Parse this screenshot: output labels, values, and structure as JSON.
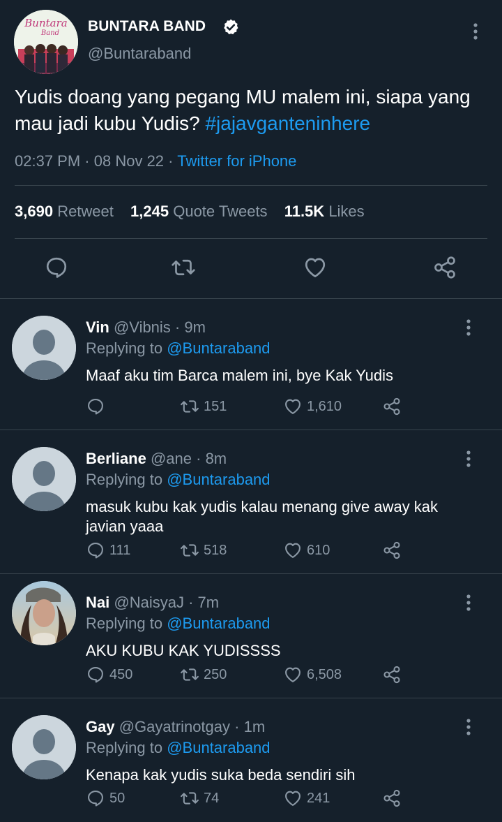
{
  "tweet": {
    "author_name": "BUNTARA BAND",
    "author_handle": "@Buntaraband",
    "avatar_logo_text": "Buntara Band",
    "text": "Yudis doang yang pegang MU malem ini, siapa yang mau jadi kubu Yudis? ",
    "hashtag": "#jajavganteninhere",
    "time": "02:37 PM",
    "date": "08 Nov 22",
    "source": "Twitter for iPhone",
    "retweets": "3,690",
    "retweets_label": "Retweet",
    "quotes": "1,245",
    "quotes_label": "Quote Tweets",
    "likes": "11.5K",
    "likes_label": "Likes"
  },
  "replies": [
    {
      "name": "Vin",
      "handle": "@Vibnis",
      "time": "9m",
      "replying_label": "Replying to",
      "mention": "@Buntaraband",
      "text": "Maaf aku tim Barca malem ini, bye Kak Yudis",
      "reply_count": "",
      "retweet_count": "151",
      "like_count": "1,610"
    },
    {
      "name": "Berliane",
      "handle": "@ane",
      "time": "8m",
      "replying_label": "Replying to",
      "mention": "@Buntaraband",
      "text": "masuk kubu kak yudis kalau menang give away kak javian yaaa",
      "reply_count": "111",
      "retweet_count": "518",
      "like_count": "610"
    },
    {
      "name": "Nai",
      "handle": "@NaisyaJ",
      "time": "7m",
      "replying_label": "Replying to",
      "mention": "@Buntaraband",
      "text": "AKU KUBU KAK YUDISSSS",
      "reply_count": "450",
      "retweet_count": "250",
      "like_count": "6,508"
    },
    {
      "name": "Gay",
      "handle": "@Gayatrinotgay",
      "time": "1m",
      "replying_label": "Replying to",
      "mention": "@Buntaraband",
      "text": "Kenapa kak yudis suka beda sendiri sih",
      "reply_count": "50",
      "retweet_count": "74",
      "like_count": "241"
    }
  ],
  "colors": {
    "background": "#15202b",
    "accent": "#1d9bf0",
    "muted": "#8b98a5",
    "divider": "#38444d"
  },
  "icons": [
    "verified-icon",
    "more-icon",
    "reply-icon",
    "retweet-icon",
    "like-icon",
    "share-icon",
    "default-avatar-icon"
  ]
}
